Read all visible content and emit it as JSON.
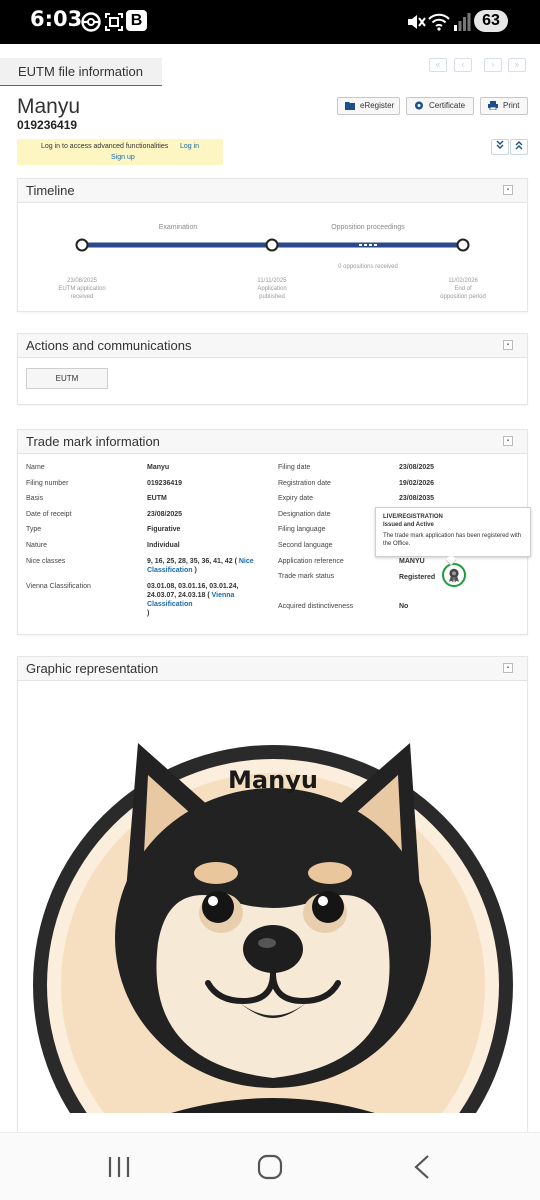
{
  "status_bar": {
    "time": "6:03",
    "badge": "B",
    "battery": "63"
  },
  "header": {
    "tab": "EUTM file information",
    "pager": [
      "«",
      "‹",
      "›",
      "»"
    ],
    "title": "Manyu",
    "number": "019236419",
    "buttons": {
      "eregister": "eRegister",
      "certificate": "Certificate",
      "print": "Print"
    },
    "login_text": "Log in to access advanced functionalities",
    "login_link": "Log in",
    "signup_link": "Sign up"
  },
  "timeline": {
    "heading": "Timeline",
    "stage1": "Examination",
    "stage2": "Opposition proceedings",
    "oppositions": "0 oppositions received",
    "milestones": [
      {
        "date": "23/08/2025",
        "line1": "EUTM application",
        "line2": "received"
      },
      {
        "date": "11/11/2025",
        "line1": "Application",
        "line2": "published"
      },
      {
        "date": "11/02/2026",
        "line1": "End of",
        "line2": "opposition period"
      }
    ]
  },
  "actions": {
    "heading": "Actions and communications",
    "button": "EUTM"
  },
  "trademark": {
    "heading": "Trade mark information",
    "left": [
      {
        "label": "Name",
        "value": "Manyu"
      },
      {
        "label": "Filing number",
        "value": "019236419"
      },
      {
        "label": "Basis",
        "value": "EUTM"
      },
      {
        "label": "Date of receipt",
        "value": "23/08/2025"
      },
      {
        "label": "Type",
        "value": "Figurative"
      },
      {
        "label": "Nature",
        "value": "Individual"
      }
    ],
    "nice_label": "Nice classes",
    "nice_value": "9, 16, 25, 28, 35, 36, 41, 42",
    "nice_link": "Nice Classification",
    "vienna_label": "Vienna Classification",
    "vienna_value_1": "03.01.08, 03.01.16, 03.01.24,",
    "vienna_value_2": "24.03.07, 24.03.18",
    "vienna_link": "Vienna Classification",
    "right": [
      {
        "label": "Filing date",
        "value": "23/08/2025"
      },
      {
        "label": "Registration date",
        "value": "19/02/2026"
      },
      {
        "label": "Expiry date",
        "value": "23/08/2035"
      },
      {
        "label": "Designation date",
        "value": ""
      },
      {
        "label": "Filing language",
        "value": ""
      },
      {
        "label": "Second language",
        "value": ""
      },
      {
        "label": "Application reference",
        "value": "MANYU"
      },
      {
        "label": "Trade mark status",
        "value": "Registered"
      },
      {
        "label": "Acquired distinctiveness",
        "value": "No"
      }
    ],
    "tooltip": {
      "title": "LIVE/REGISTRATION",
      "subtitle": "Issued and Active",
      "body": "The trade mark application has been registered with the Office."
    }
  },
  "graphic": {
    "heading": "Graphic representation",
    "logo_text": "Manyu"
  },
  "colors": {
    "accent": "#2b4a8b",
    "status_green": "#1b9c3a",
    "link": "#1a6aa8",
    "notice": "#fdf6c3"
  }
}
